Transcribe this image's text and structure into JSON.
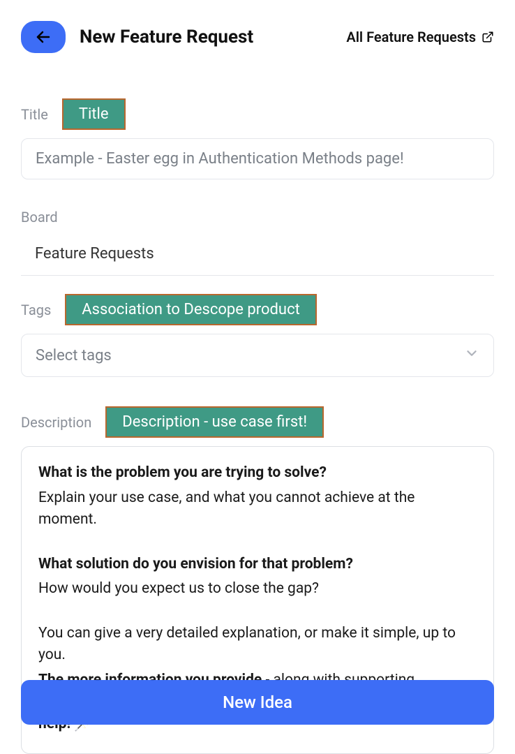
{
  "header": {
    "title": "New Feature Request",
    "all_link": "All Feature Requests"
  },
  "title_field": {
    "label": "Title",
    "callout": "Title",
    "placeholder": "Example - Easter egg in Authentication Methods page!"
  },
  "board_field": {
    "label": "Board",
    "value": "Feature Requests"
  },
  "tags_field": {
    "label": "Tags",
    "callout": "Association to Descope product",
    "placeholder": "Select tags"
  },
  "description_field": {
    "label": "Description",
    "callout": "Description - use case first!",
    "q1": "What is the problem you are trying to solve?",
    "a1": "Explain your use case, and what you cannot achieve at the moment.",
    "q2": "What solution do you envision for that problem?",
    "a2": "How would you expect us to close the gap?",
    "detail1": "You can give a very detailed explanation, or make it simple, up to you.",
    "detail2a": "The more information you provide",
    "detail2b": " - along with supporting elements such as images - ",
    "detail2c": "the better we will all understand and help! 🪄"
  },
  "submit": {
    "label": "New Idea"
  }
}
